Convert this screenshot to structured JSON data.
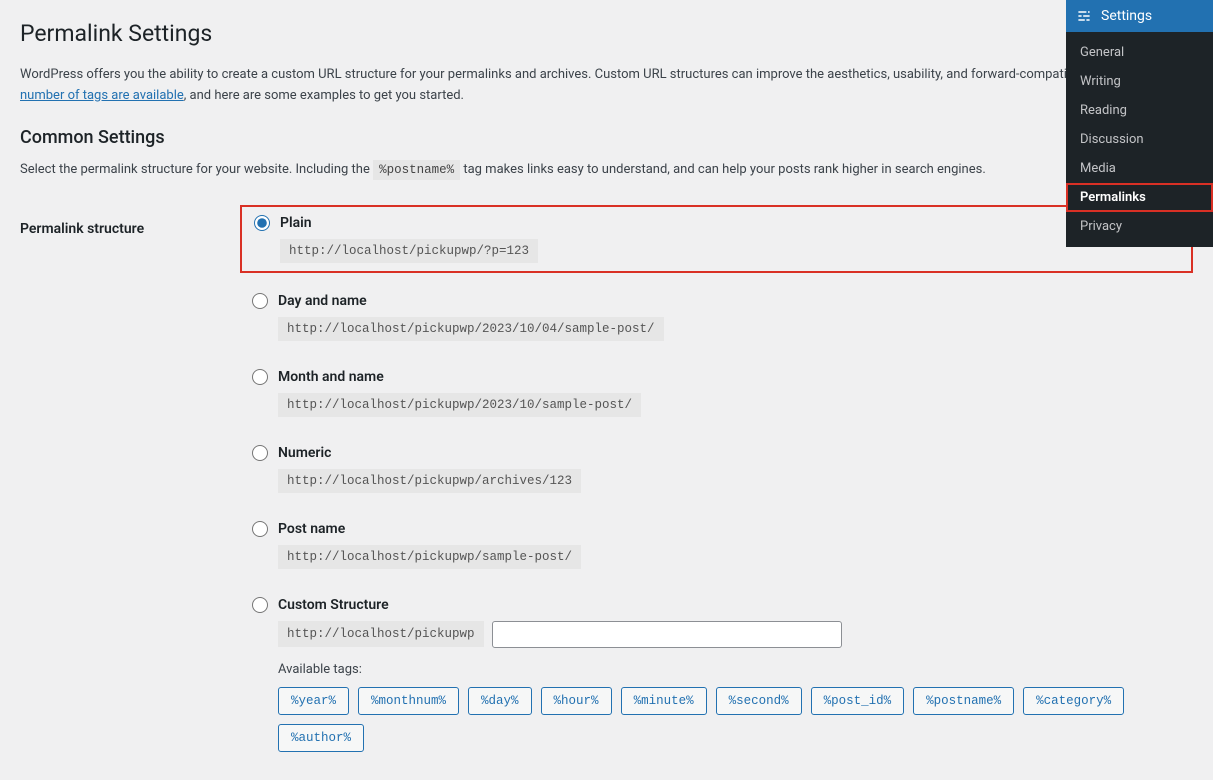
{
  "page": {
    "title": "Permalink Settings",
    "intro_before_link": "WordPress offers you the ability to create a custom URL structure for your permalinks and archives. Custom URL structures can improve the aesthetics, usability, and forward-compatibility of your links. A ",
    "intro_link": "number of tags are available",
    "intro_after_link": ", and here are some examples to get you started.",
    "common_heading": "Common Settings",
    "common_desc_before": "Select the permalink structure for your website. Including the ",
    "postname_tag": "%postname%",
    "common_desc_after": " tag makes links easy to understand, and can help your posts rank higher in search engines.",
    "row_label": "Permalink structure"
  },
  "options": [
    {
      "label": "Plain",
      "url": "http://localhost/pickupwp/?p=123",
      "checked": true,
      "highlight": true
    },
    {
      "label": "Day and name",
      "url": "http://localhost/pickupwp/2023/10/04/sample-post/",
      "checked": false,
      "highlight": false
    },
    {
      "label": "Month and name",
      "url": "http://localhost/pickupwp/2023/10/sample-post/",
      "checked": false,
      "highlight": false
    },
    {
      "label": "Numeric",
      "url": "http://localhost/pickupwp/archives/123",
      "checked": false,
      "highlight": false
    },
    {
      "label": "Post name",
      "url": "http://localhost/pickupwp/sample-post/",
      "checked": false,
      "highlight": false
    }
  ],
  "custom": {
    "label": "Custom Structure",
    "prefix": "http://localhost/pickupwp",
    "value": "",
    "available_label": "Available tags:"
  },
  "tags": [
    "%year%",
    "%monthnum%",
    "%day%",
    "%hour%",
    "%minute%",
    "%second%",
    "%post_id%",
    "%postname%",
    "%category%",
    "%author%"
  ],
  "sidebar": {
    "title": "Settings",
    "items": [
      {
        "label": "General",
        "active": false
      },
      {
        "label": "Writing",
        "active": false
      },
      {
        "label": "Reading",
        "active": false
      },
      {
        "label": "Discussion",
        "active": false
      },
      {
        "label": "Media",
        "active": false
      },
      {
        "label": "Permalinks",
        "active": true
      },
      {
        "label": "Privacy",
        "active": false
      }
    ]
  }
}
